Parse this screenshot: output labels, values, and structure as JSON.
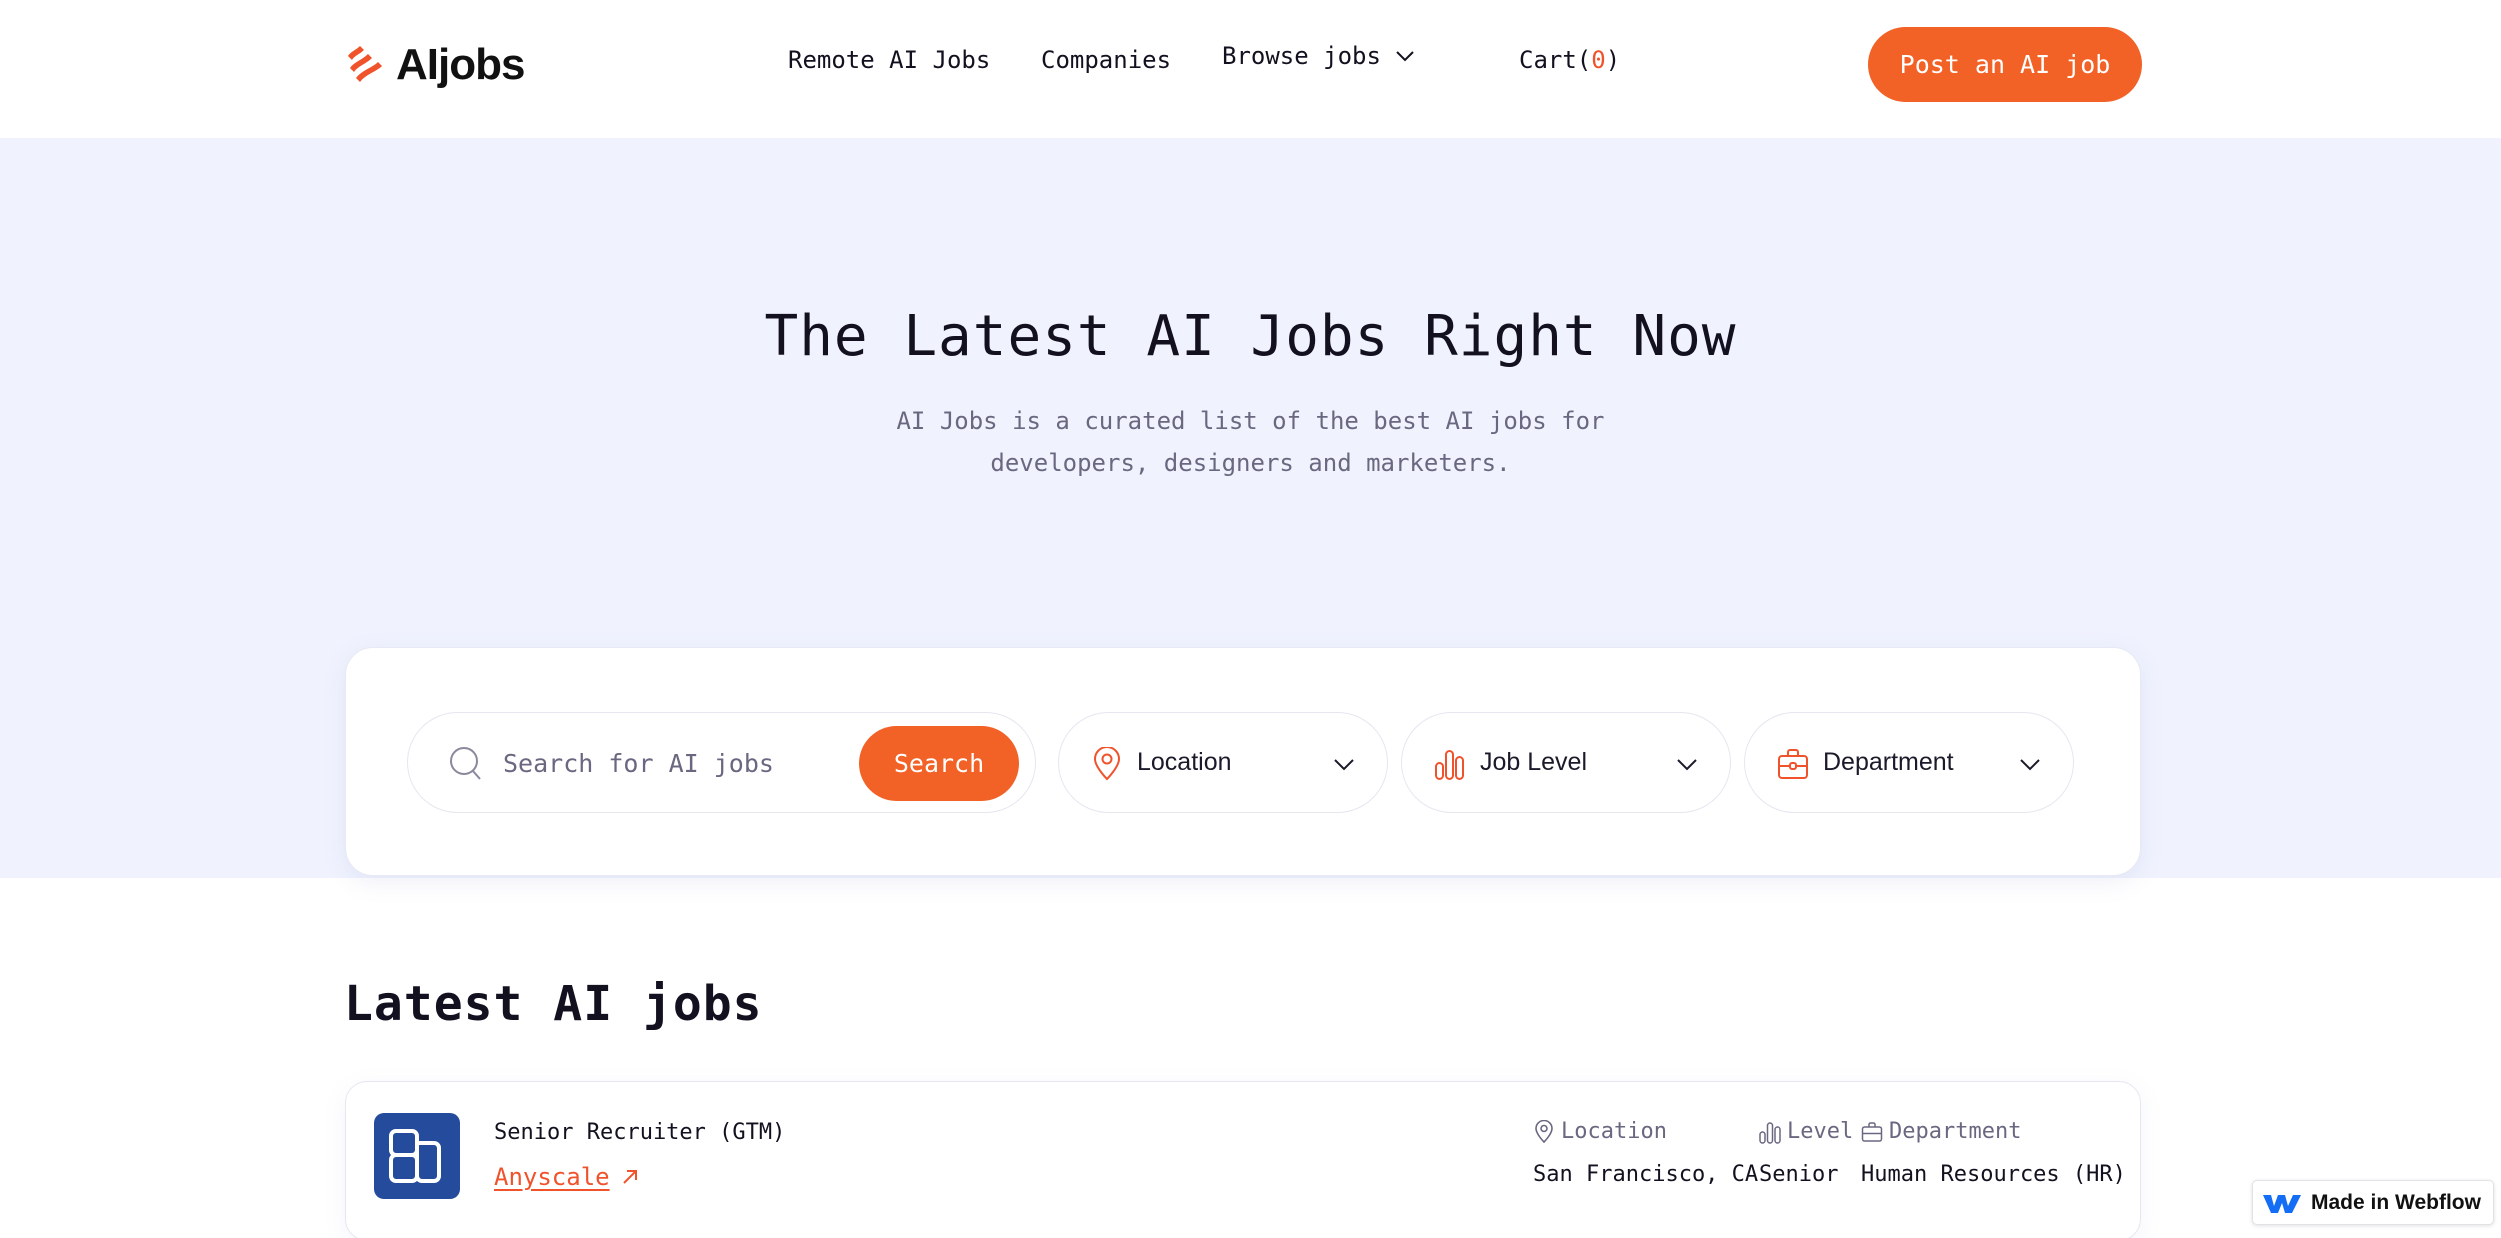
{
  "header": {
    "logo_text": "AIjobs",
    "nav": {
      "remote": "Remote AI Jobs",
      "companies": "Companies",
      "browse": "Browse jobs",
      "cart_label": "Cart(",
      "cart_count": "0",
      "cart_close": ")"
    },
    "post_button": "Post an AI job"
  },
  "hero": {
    "title": "The Latest AI Jobs Right Now",
    "subtitle_line1": "AI Jobs is a curated list of the best AI jobs for",
    "subtitle_line2": "developers, designers and marketers."
  },
  "search": {
    "placeholder": "Search for AI jobs",
    "value": "",
    "button": "Search",
    "filters": {
      "location": "Location",
      "job_level": "Job Level",
      "department": "Department"
    }
  },
  "latest": {
    "title": "Latest AI jobs",
    "jobs": [
      {
        "title": "Senior Recruiter (GTM)",
        "company": "Anyscale",
        "location_label": "Location",
        "level_label": "Level",
        "department_label": "Department",
        "location": "San Francisco, CA",
        "level": "Senior",
        "department": "Human Resources (HR)"
      }
    ]
  },
  "badge": {
    "text": "Made in Webflow"
  },
  "colors": {
    "accent": "#f26126",
    "hero_bg": "#f0f3fe",
    "company_logo_bg": "#254c9c",
    "text": "#13111f",
    "muted": "#6a6880"
  }
}
